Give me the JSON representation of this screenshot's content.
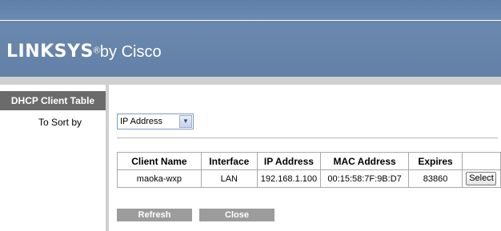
{
  "brand": {
    "logo": "LINKSYS",
    "reg": "®",
    "suffix": "by Cisco"
  },
  "sidebar": {
    "title": "DHCP Client Table",
    "sort_label": "To Sort by"
  },
  "sort": {
    "selected": "IP Address"
  },
  "table": {
    "headers": [
      "Client Name",
      "Interface",
      "IP Address",
      "MAC Address",
      "Expires",
      ""
    ],
    "rows": [
      {
        "client_name": "maoka-wxp",
        "interface": "LAN",
        "ip": "192.168.1.100",
        "mac": "00:15:58:7F:9B:D7",
        "expires": "83860",
        "action": "Select"
      }
    ]
  },
  "buttons": {
    "refresh": "Refresh",
    "close": "Close"
  },
  "colors": {
    "header_blue": "#6b88ae",
    "sidebar_title_bg": "#6b6b6b",
    "button_gray": "#9c9c9c"
  }
}
